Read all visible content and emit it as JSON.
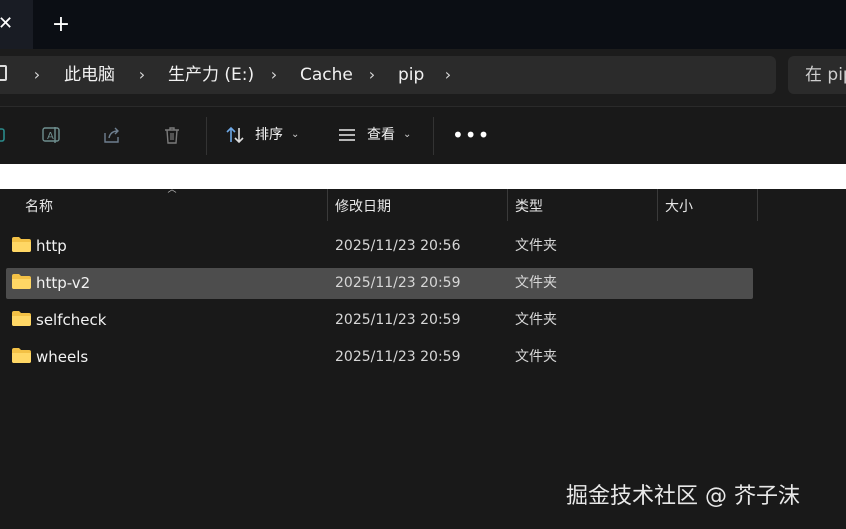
{
  "tab": {
    "close_glyph": "✕",
    "new_tab_glyph": "+"
  },
  "breadcrumb": {
    "items": [
      "此电脑",
      "生产力 (E:)",
      "Cache",
      "pip"
    ],
    "separator": "›"
  },
  "search": {
    "placeholder": "在 pip"
  },
  "toolbar": {
    "sort_label": "排序",
    "view_label": "查看",
    "more_glyph": "•••",
    "caret": "⌄"
  },
  "columns": {
    "name": "名称",
    "modified": "修改日期",
    "type": "类型",
    "size": "大小"
  },
  "rows": [
    {
      "name": "http",
      "modified": "2025/11/23 20:56",
      "type": "文件夹",
      "size": "",
      "selected": false
    },
    {
      "name": "http-v2",
      "modified": "2025/11/23 20:59",
      "type": "文件夹",
      "size": "",
      "selected": true
    },
    {
      "name": "selfcheck",
      "modified": "2025/11/23 20:59",
      "type": "文件夹",
      "size": "",
      "selected": false
    },
    {
      "name": "wheels",
      "modified": "2025/11/23 20:59",
      "type": "文件夹",
      "size": "",
      "selected": false
    }
  ],
  "watermark": "掘金技术社区 @ 芥子沫",
  "colors": {
    "background": "#191919",
    "selected_row": "#4d4d4d",
    "folder": "#f3c146"
  }
}
